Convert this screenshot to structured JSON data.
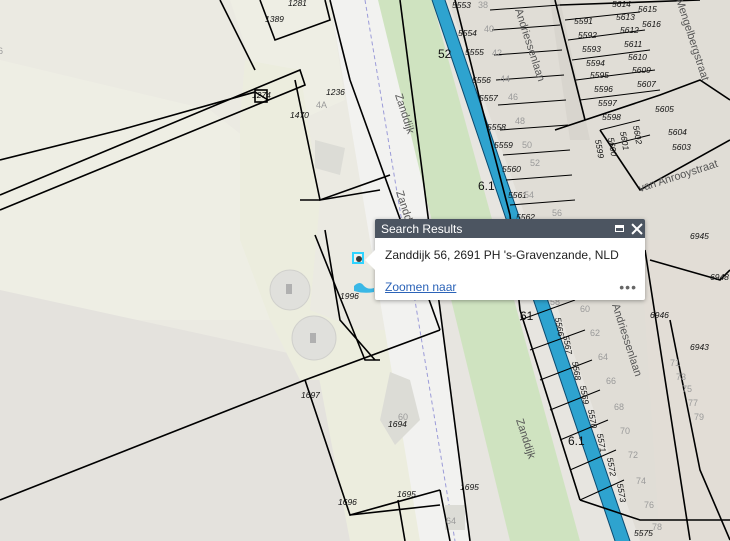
{
  "popup": {
    "title": "Search Results",
    "address": "Zanddijk 56, 2691 PH 's-Gravenzande, NLD",
    "zoom_link": "Zoomen naar",
    "more": "•••"
  },
  "colors": {
    "water_line": "#2ea3cf",
    "green_strip": "#cfe3c0",
    "road": "#f4f4f4",
    "parcels_line": "#000000",
    "popup_header": "#4c5561",
    "marker": "#2fd3ff"
  },
  "map": {
    "streets": [
      "Zanddijk",
      "Zanddijk",
      "Zanddijk",
      "Andriessenlaan",
      "Andriessenlaan",
      "van Anrooystraat",
      "Mengelbergstraat"
    ],
    "km_labels": [
      "52",
      "6.1",
      "61",
      "6.1"
    ],
    "parcels": [
      "1281",
      "1389",
      "5553",
      "5554",
      "5555",
      "5556",
      "5557",
      "5558",
      "5559",
      "5560",
      "5561",
      "5562",
      "5591",
      "5592",
      "5593",
      "5594",
      "5595",
      "5596",
      "5597",
      "5598",
      "5599",
      "5600",
      "5601",
      "5602",
      "5603",
      "5604",
      "5605",
      "5607",
      "5609",
      "5610",
      "5611",
      "5612",
      "5613",
      "5614",
      "5615",
      "5616",
      "1236",
      "1470",
      "1274",
      "1996",
      "1697",
      "1694",
      "1696",
      "1695",
      "1695",
      "6945",
      "6946",
      "6948",
      "6943",
      "5566",
      "5567",
      "5568",
      "5569",
      "5570",
      "5571",
      "5572",
      "5573",
      "5575"
    ],
    "house_numbers": [
      "38",
      "40",
      "42",
      "44",
      "46",
      "48",
      "50",
      "52",
      "54",
      "56",
      "58",
      "60",
      "62",
      "64",
      "66",
      "68",
      "70",
      "72",
      "74",
      "76",
      "78",
      "71",
      "73",
      "75",
      "77",
      "79",
      "60",
      "64",
      "4A",
      "6"
    ]
  }
}
